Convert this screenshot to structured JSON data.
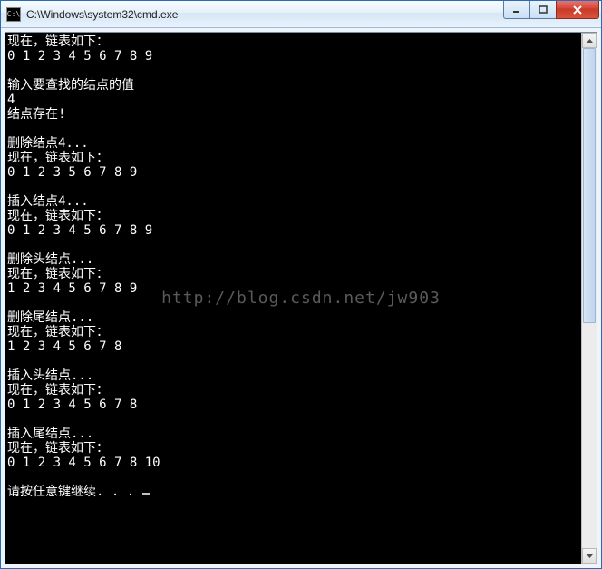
{
  "window": {
    "title": "C:\\Windows\\system32\\cmd.exe",
    "icon_label": "C:\\"
  },
  "watermark": "http://blog.csdn.net/jw903",
  "console": {
    "lines": [
      "现在，链表如下：",
      "0 1 2 3 4 5 6 7 8 9",
      "",
      "输入要查找的结点的值",
      "4",
      "结点存在!",
      "",
      "删除结点4...",
      "现在，链表如下：",
      "0 1 2 3 5 6 7 8 9",
      "",
      "插入结点4...",
      "现在，链表如下：",
      "0 1 2 3 4 5 6 7 8 9",
      "",
      "删除头结点...",
      "现在，链表如下：",
      "1 2 3 4 5 6 7 8 9",
      "",
      "删除尾结点...",
      "现在，链表如下：",
      "1 2 3 4 5 6 7 8",
      "",
      "插入头结点...",
      "现在，链表如下：",
      "0 1 2 3 4 5 6 7 8",
      "",
      "插入尾结点...",
      "现在，链表如下：",
      "0 1 2 3 4 5 6 7 8 10",
      "",
      "请按任意键继续. . . "
    ]
  }
}
